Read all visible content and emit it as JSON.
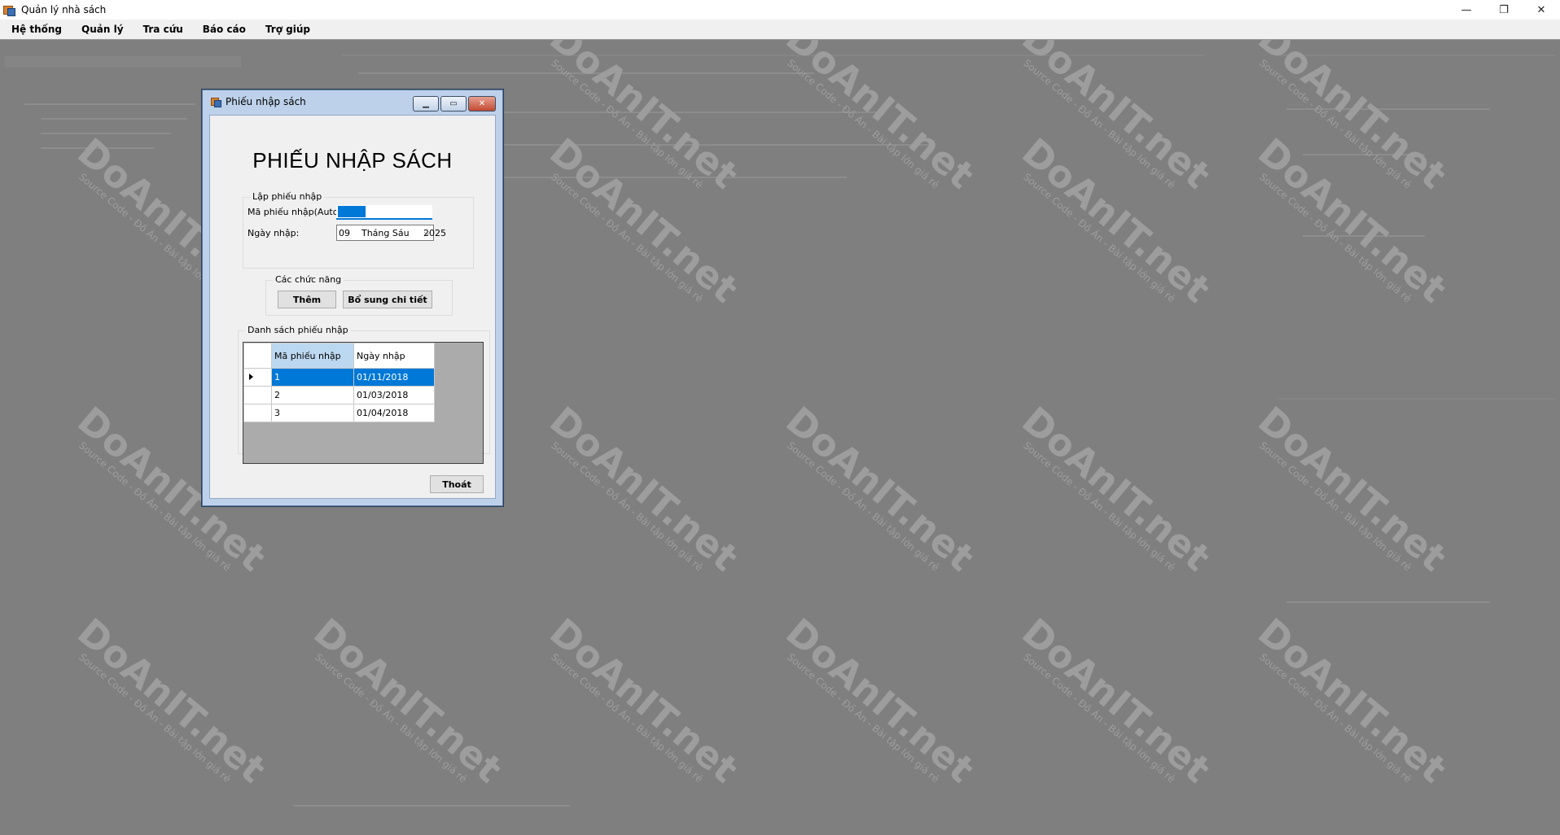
{
  "window": {
    "title": "Quản lý nhà sách",
    "minimize": "—",
    "maximize": "❐",
    "close": "✕"
  },
  "menu": [
    "Hệ thống",
    "Quản lý",
    "Tra cứu",
    "Báo cáo",
    "Trợ giúp"
  ],
  "watermark": {
    "brand": "DoAnIT.net",
    "tagline": "Source Code - Đồ Án - Bài tập lớn giá rẻ"
  },
  "dialog": {
    "title": "Phiếu nhập sách",
    "heading": "PHIẾU NHẬP SÁCH",
    "create_group": {
      "legend": "Lập phiếu nhập",
      "id_label": "Mã phiếu nhập(Auto):",
      "id_value": "",
      "date_label": "Ngày nhập:",
      "date_value": "09    Tháng Sáu     2025"
    },
    "functions_group": {
      "legend": "Các chức năng",
      "add_button": "Thêm",
      "detail_button": "Bổ sung chi tiết"
    },
    "list_group": {
      "legend": "Danh sách phiếu nhập",
      "columns": [
        "Mã phiếu nhập",
        "Ngày nhập"
      ],
      "rows": [
        {
          "id": "1",
          "date": "01/11/2018"
        },
        {
          "id": "2",
          "date": "01/03/2018"
        },
        {
          "id": "3",
          "date": "01/04/2018"
        }
      ],
      "selected_row": 0
    },
    "exit_button": "Thoát"
  },
  "colors": {
    "selection": "#0078d7",
    "sorted_header": "#bcd8f0",
    "overlay": "#7f7f7f"
  }
}
